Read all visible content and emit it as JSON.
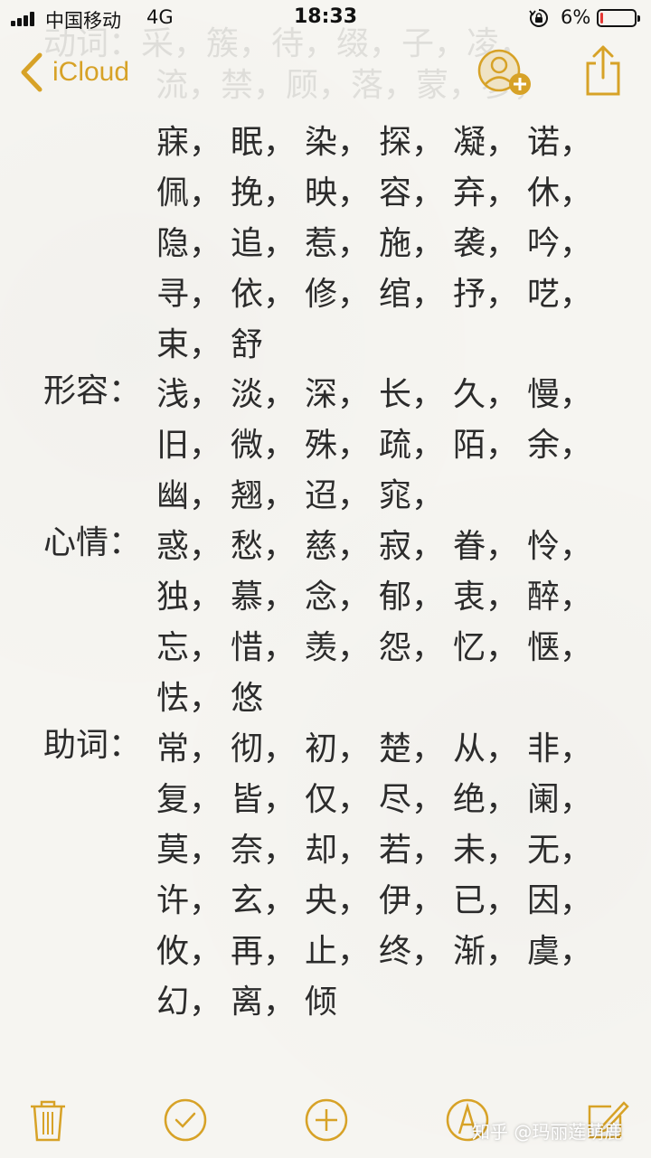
{
  "status_bar": {
    "carrier": "中国移动",
    "network": "4G",
    "time": "18:33",
    "battery_percent": "6%",
    "battery_level": 0.06,
    "battery_color": "#e53935"
  },
  "nav": {
    "back_label": "iCloud",
    "accent_color": "#d7a227",
    "icons": [
      "chevron-left-icon",
      "add-person-icon",
      "share-icon"
    ]
  },
  "faded_rows": [
    "动词：采，簇，待，缀，子，凌，",
    "流，禁，顾，落，蒙，参，"
  ],
  "sections": [
    {
      "label": "",
      "rows": [
        [
          "寐，",
          "眠，",
          "染，",
          "探，",
          "凝，",
          "诺，"
        ],
        [
          "佩，",
          "挽，",
          "映，",
          "容，",
          "弃，",
          "休，"
        ],
        [
          "隐，",
          "追，",
          "惹，",
          "施，",
          "袭，",
          "吟，"
        ],
        [
          "寻，",
          "依，",
          "修，",
          "绾，",
          "抒，",
          "呓，"
        ],
        [
          "束，",
          "舒"
        ]
      ]
    },
    {
      "label": "形容：",
      "rows": [
        [
          "浅，",
          "淡，",
          "深，",
          "长，",
          "久，",
          "慢，"
        ],
        [
          "旧，",
          "微，",
          "殊，",
          "疏，",
          "陌，",
          "余，"
        ],
        [
          "幽，",
          "翘，",
          "迢，",
          "窕，"
        ]
      ]
    },
    {
      "label": "心情：",
      "rows": [
        [
          "惑，",
          "愁，",
          "慈，",
          "寂，",
          "眷，",
          "怜，"
        ],
        [
          "独，",
          "慕，",
          "念，",
          "郁，",
          "衷，",
          "醉，"
        ],
        [
          "忘，",
          "惜，",
          "羡，",
          "怨，",
          "忆，",
          "惬，"
        ],
        [
          "怯，",
          "悠"
        ]
      ]
    },
    {
      "label": "助词：",
      "rows": [
        [
          "常，",
          "彻，",
          "初，",
          "楚，",
          "从，",
          "非，"
        ],
        [
          "复，",
          "皆，",
          "仅，",
          "尽，",
          "绝，",
          "阑，"
        ],
        [
          "莫，",
          "奈，",
          "却，",
          "若，",
          "未，",
          "无，"
        ],
        [
          "许，",
          "玄，",
          "央，",
          "伊，",
          "已，",
          "因，"
        ],
        [
          "攸，",
          "再，",
          "止，",
          "终，",
          "渐，",
          "虞，"
        ],
        [
          "幻，",
          "离，",
          "倾"
        ]
      ]
    }
  ],
  "toolbar": {
    "icons": [
      "trash-icon",
      "checklist-icon",
      "add-icon",
      "markup-pen-icon",
      "compose-icon"
    ]
  },
  "watermark": "知乎 @玛丽莲萌鹿"
}
